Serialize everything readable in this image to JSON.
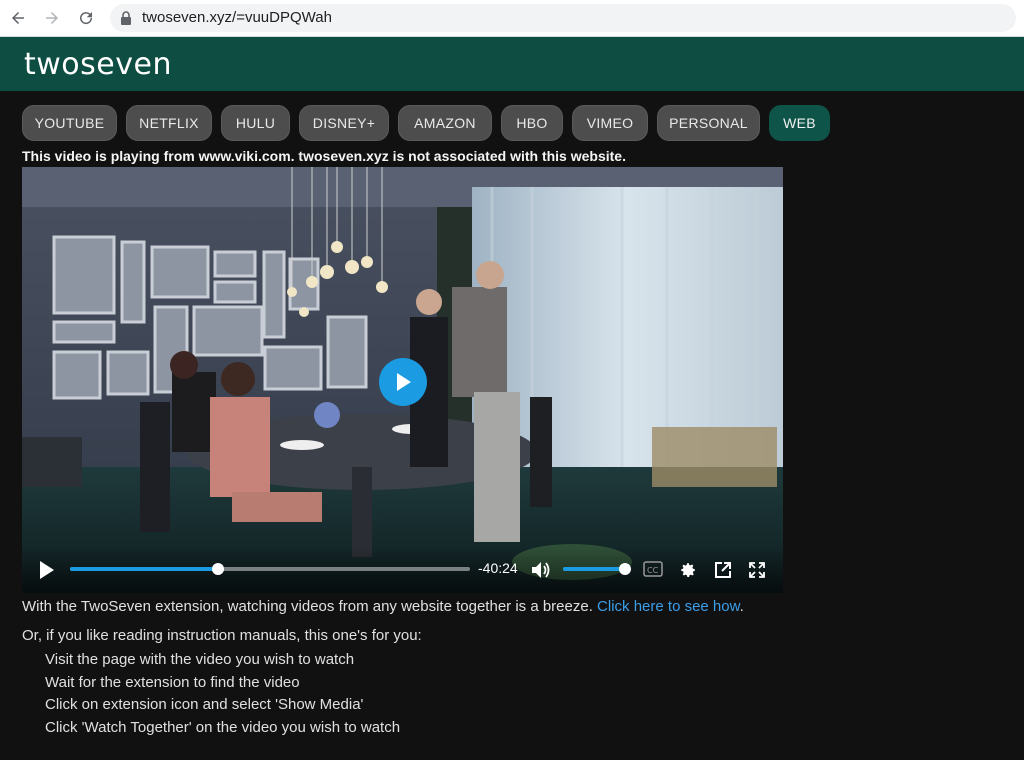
{
  "browser": {
    "url": "twoseven.xyz/=vuuDPQWah",
    "icons": [
      "back-arrow-icon",
      "forward-arrow-icon",
      "reload-icon",
      "lock-icon"
    ]
  },
  "site": {
    "logo": "twoseven",
    "header_color": "#0d4d42"
  },
  "tabs": [
    {
      "label": "YOUTUBE",
      "active": false
    },
    {
      "label": "NETFLIX",
      "active": false
    },
    {
      "label": "HULU",
      "active": false
    },
    {
      "label": "DISNEY+",
      "active": false
    },
    {
      "label": "AMAZON",
      "active": false
    },
    {
      "label": "HBO",
      "active": false
    },
    {
      "label": "VIMEO",
      "active": false
    },
    {
      "label": "PERSONAL",
      "active": false
    },
    {
      "label": "WEB",
      "active": true
    }
  ],
  "notice": "This video is playing from www.viki.com. twoseven.xyz is not associated with this website.",
  "player": {
    "time_remaining": "-40:24",
    "progress": 0.37,
    "volume": 1.0,
    "accent": "#1a9be2",
    "icons": [
      "play-icon",
      "volume-icon",
      "captions-icon",
      "settings-gear-icon",
      "popout-icon",
      "fullscreen-icon"
    ]
  },
  "extension_text": {
    "prefix": "With the TwoSeven extension, watching videos from any website together is a breeze.",
    "link": "Click here to see how",
    "suffix": "."
  },
  "manual": {
    "intro": "Or, if you like reading instruction manuals, this one's for you:",
    "steps": [
      "Visit the page with the video you wish to watch",
      "Wait for the extension to find the video",
      "Click on extension icon and select 'Show Media'",
      "Click 'Watch Together' on the video you wish to watch"
    ]
  }
}
